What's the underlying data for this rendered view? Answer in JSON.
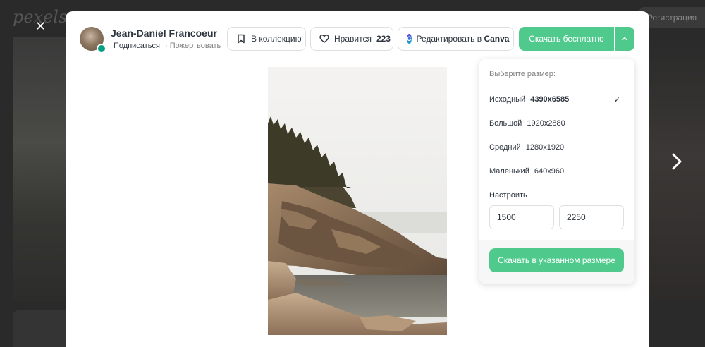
{
  "background": {
    "logo": "pexels",
    "register_label": "Регистрация"
  },
  "overlay": {
    "close_icon": "close-icon",
    "next_icon": "chevron-right-icon"
  },
  "author": {
    "name": "Jean-Daniel Francoeur",
    "follow_label": "Подписаться",
    "donate_label": "· Пожертвовать"
  },
  "toolbar": {
    "collection_label": "В коллекцию",
    "like_label": "Нравится",
    "like_count": "223",
    "canva_label_prefix": "Редактировать в ",
    "canva_label_brand": "Canva",
    "download_label": "Скачать бесплатно"
  },
  "size_panel": {
    "heading": "Выберите размер:",
    "options": [
      {
        "name": "Исходный",
        "dims": "4390x6585",
        "selected": true
      },
      {
        "name": "Большой",
        "dims": "1920x2880",
        "selected": false
      },
      {
        "name": "Средний",
        "dims": "1280x1920",
        "selected": false
      },
      {
        "name": "Маленький",
        "dims": "640x960",
        "selected": false
      }
    ],
    "custom_label": "Настроить",
    "custom_width": "1500",
    "custom_height": "2250",
    "submit_label": "Скачать в указанном размере"
  },
  "colors": {
    "accent": "#4fca8c",
    "text": "#2c343e",
    "muted": "#7f7f7f"
  }
}
